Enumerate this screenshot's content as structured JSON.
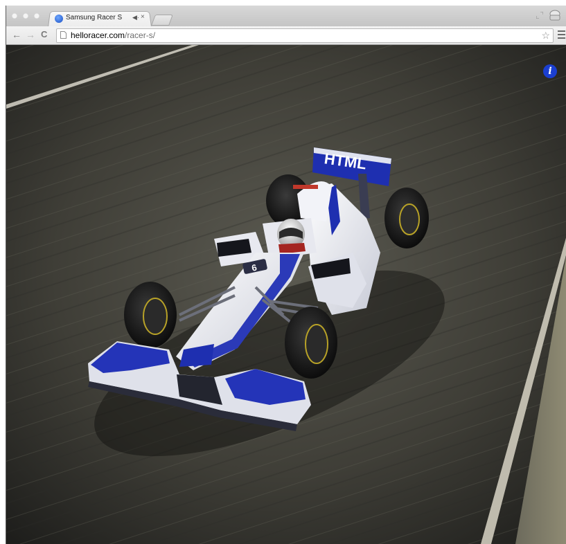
{
  "browser": {
    "tab": {
      "title": "Samsung Racer S",
      "favicon": "samsung-racer-favicon",
      "audio_icon": "◀·",
      "close_icon": "×"
    },
    "toolbar": {
      "back_icon": "←",
      "forward_icon": "→",
      "reload_icon": "C",
      "url_host": "helloracer.com",
      "url_path": "/racer-s/",
      "bookmark_icon": "☆"
    }
  },
  "page": {
    "info_button_label": "i",
    "car_wing_text": "HTML",
    "car_number": "6",
    "accent_color": "#1b3fd0",
    "car_body_color": "#eef0f6",
    "car_accent_color": "#2b3ab8"
  }
}
